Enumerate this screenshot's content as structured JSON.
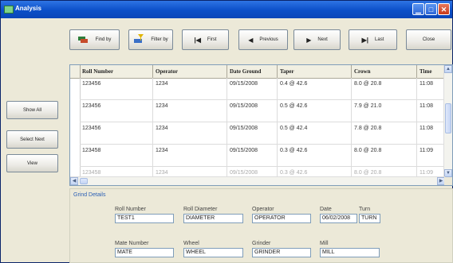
{
  "window": {
    "title": "Analysis"
  },
  "toolbar": {
    "find_by": "Find by",
    "filter_by": "Filter by",
    "first": "First",
    "previous": "Previous",
    "next": "Next",
    "last": "Last",
    "close": "Close"
  },
  "side_buttons": {
    "show_all": "Show All",
    "select_next": "Select Next",
    "view": "View"
  },
  "grid": {
    "columns": [
      "Roll Number",
      "Operator",
      "Date Ground",
      "Taper",
      "Crown",
      "Time"
    ],
    "rows": [
      [
        "123456",
        "1234",
        "09/15/2008",
        "0.4 @ 42.6",
        "8.0 @ 20.8",
        "11:08"
      ],
      [
        "123456",
        "1234",
        "09/15/2008",
        "0.5 @ 42.6",
        "7.9 @ 21.0",
        "11:08"
      ],
      [
        "123456",
        "1234",
        "09/15/2008",
        "0.5 @ 42.4",
        "7.8 @ 20.8",
        "11:08"
      ],
      [
        "123458",
        "1234",
        "09/15/2008",
        "0.3 @ 42.6",
        "8.0 @ 20.8",
        "11:09"
      ],
      [
        "123458",
        "1234",
        "09/15/2008",
        "0.3 @ 42.6",
        "8.0 @ 20.8",
        "11:09"
      ]
    ]
  },
  "details": {
    "legend": "Grind Details",
    "fields": {
      "roll_number": {
        "label": "Roll Number",
        "value": "TEST1"
      },
      "roll_diameter": {
        "label": "Roll Diameter",
        "value": "DIAMETER"
      },
      "operator": {
        "label": "Operator",
        "value": "OPERATOR"
      },
      "date": {
        "label": "Date",
        "value": "06/02/2008"
      },
      "turn": {
        "label": "Turn",
        "value": "TURN"
      },
      "mate_number": {
        "label": "Mate Number",
        "value": "MATE"
      },
      "wheel": {
        "label": "Wheel",
        "value": "WHEEL"
      },
      "grinder": {
        "label": "Grinder",
        "value": "GRINDER"
      },
      "mill": {
        "label": "Mill",
        "value": "MILL"
      }
    }
  }
}
